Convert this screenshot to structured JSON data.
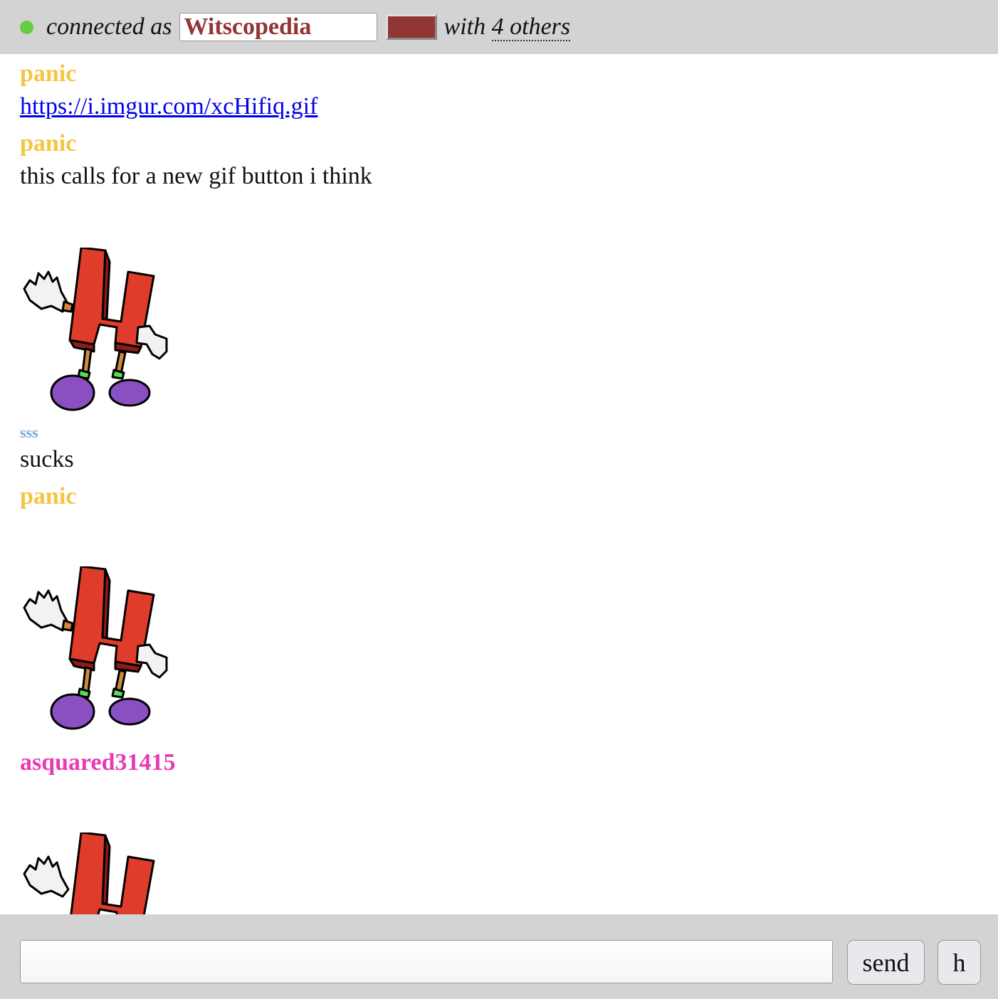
{
  "header": {
    "status": "connected",
    "status_color": "#66cc44",
    "connected_label": "connected as",
    "username": "Witscopedia",
    "user_color": "#913535",
    "with_label": "with ",
    "others_count": "4",
    "others_label": " others"
  },
  "messages": [
    {
      "author": "panic",
      "author_color": "#f5c542",
      "type": "link",
      "text": "https://i.imgur.com/xcHifiq.gif"
    },
    {
      "author": "panic",
      "author_color": "#f5c542",
      "type": "text",
      "text": "this calls for a new gif button i think"
    },
    {
      "type": "image",
      "alt": "dancing letter H gif"
    },
    {
      "author": "sss",
      "author_color": "#7aa6d8",
      "type": "text",
      "text": "sucks"
    },
    {
      "author": "panic",
      "author_color": "#f5c542",
      "type": "image",
      "alt": "dancing letter H gif"
    },
    {
      "author": "asquared31415",
      "author_color": "#e83ab6",
      "type": "image",
      "alt": "dancing letter H gif"
    }
  ],
  "composer": {
    "input_value": "",
    "send_label": "send",
    "h_label": "h"
  }
}
